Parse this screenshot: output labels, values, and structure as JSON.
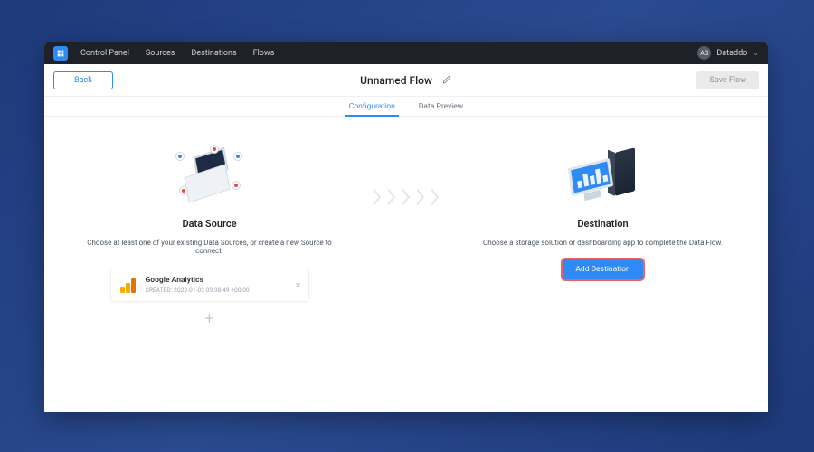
{
  "nav": {
    "items": [
      "Control Panel",
      "Sources",
      "Destinations",
      "Flows"
    ],
    "user_initials": "AG",
    "user_label": "Dataddo"
  },
  "header": {
    "back": "Back",
    "title": "Unnamed Flow",
    "save": "Save Flow"
  },
  "tabs": {
    "configuration": "Configuration",
    "preview": "Data Preview"
  },
  "source_col": {
    "heading": "Data Source",
    "subtext": "Choose at least one of your existing Data Sources, or create a new Source to connect.",
    "card": {
      "name": "Google Analytics",
      "meta": "CREATED: 2022-01-03 09:38:49 +00:00"
    },
    "add_more": "+"
  },
  "dest_col": {
    "heading": "Destination",
    "subtext": "Choose a storage solution or dashboarding app to complete the Data Flow.",
    "button": "Add Destination"
  }
}
